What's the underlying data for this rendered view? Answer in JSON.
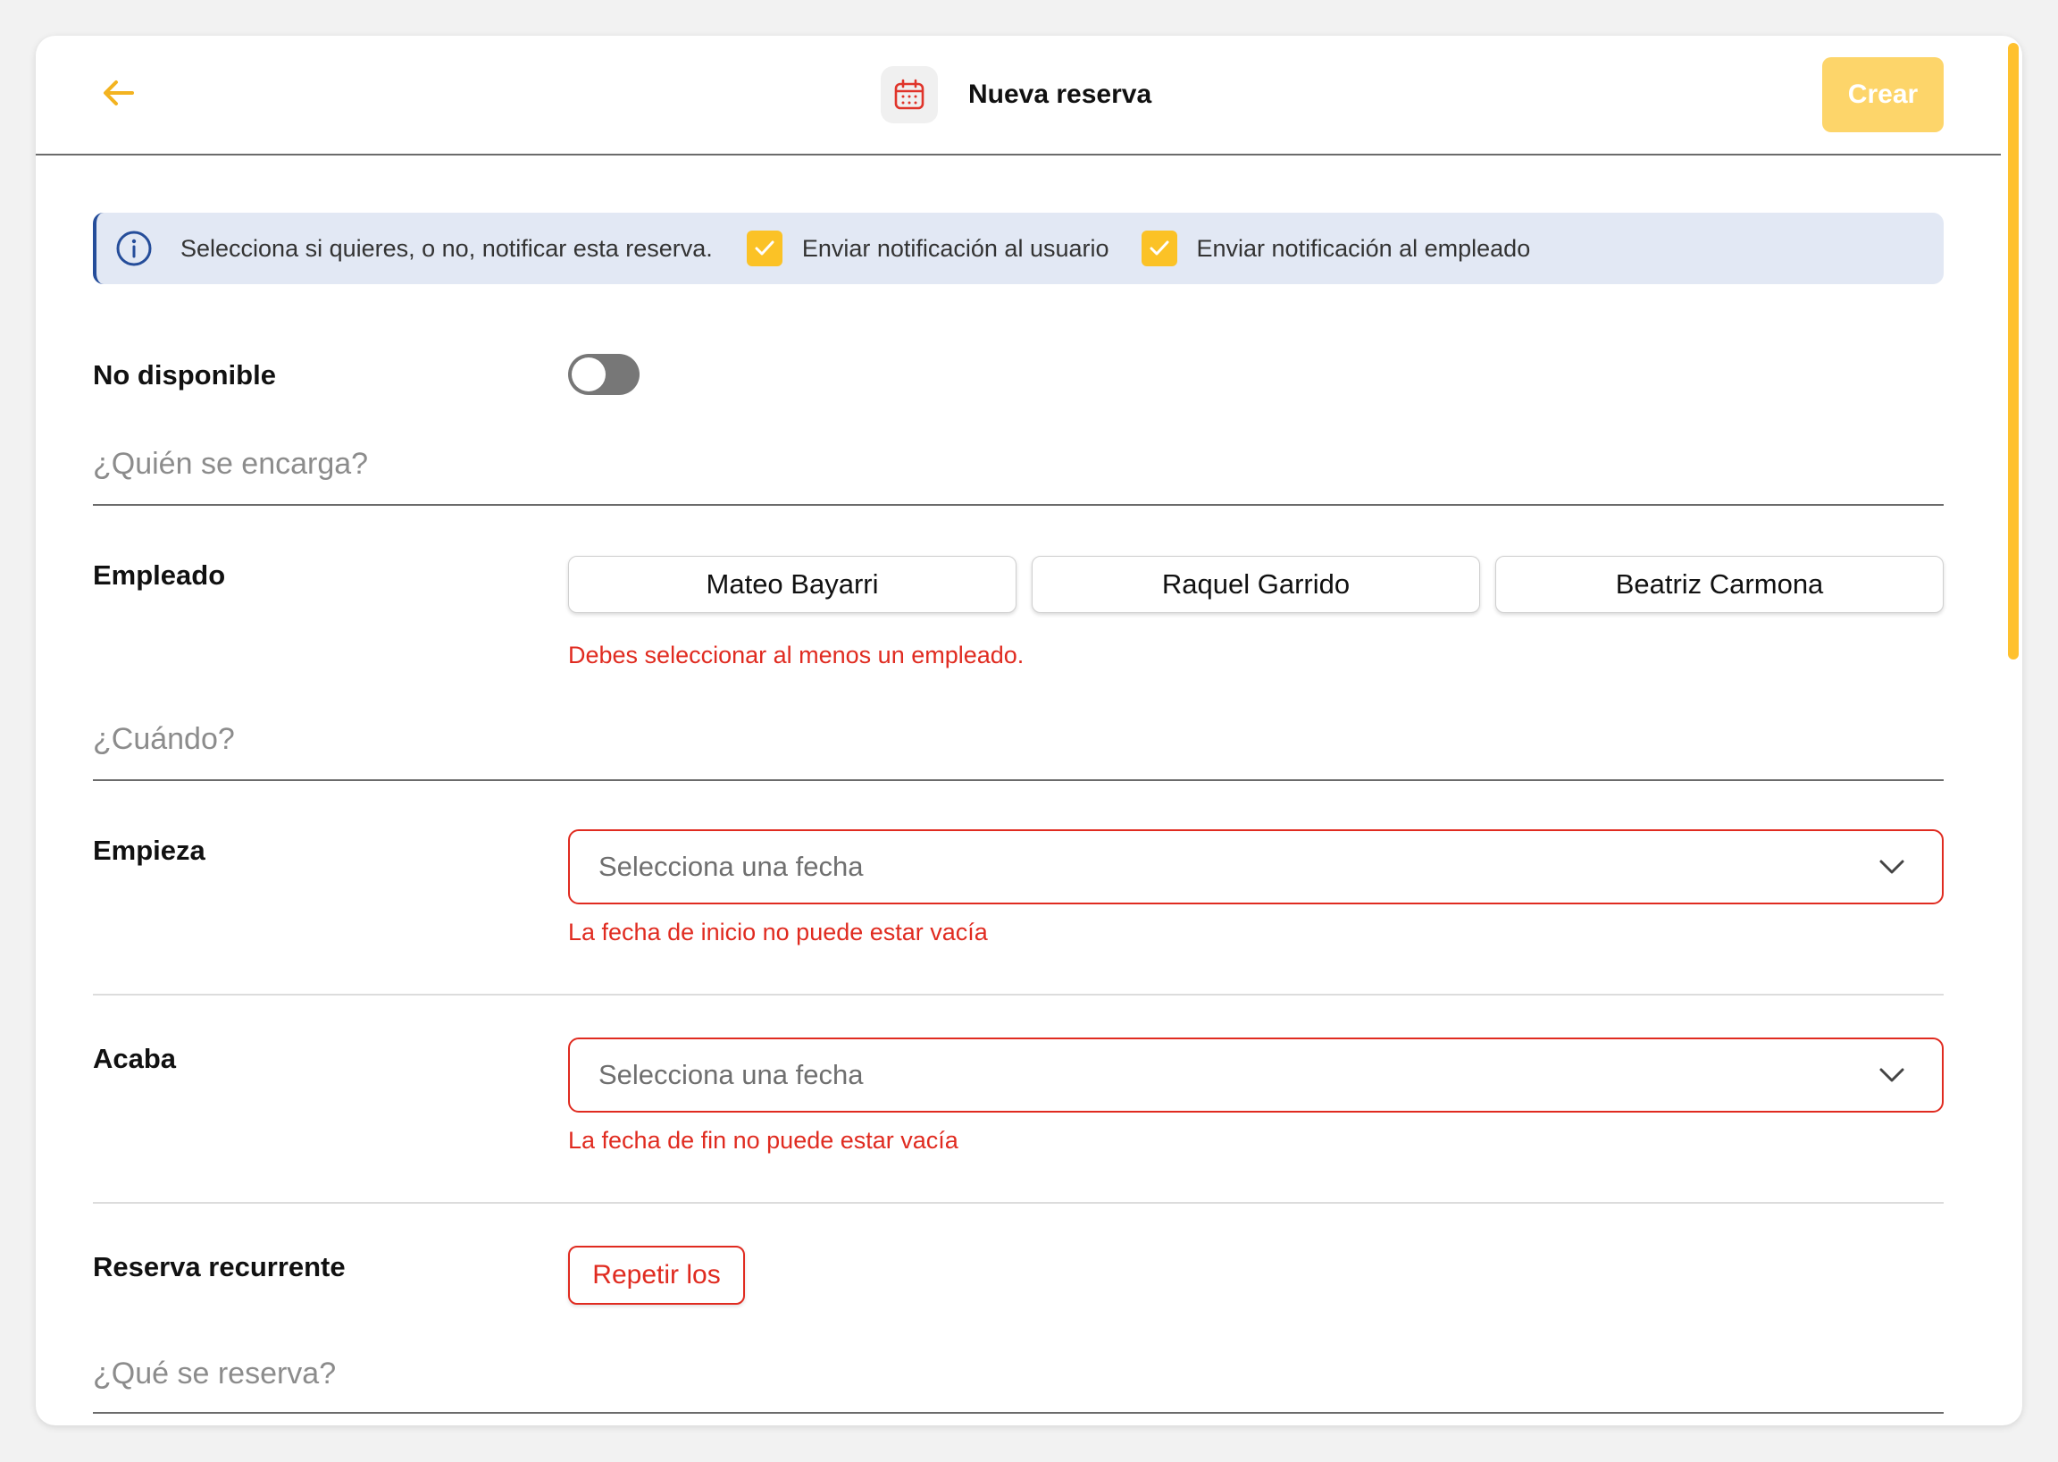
{
  "header": {
    "title": "Nueva reserva",
    "create_label": "Crear",
    "back_icon": "arrow-left-icon",
    "calendar_icon": "calendar-icon"
  },
  "banner": {
    "text": "Selecciona si quieres, o no, notificar esta reserva.",
    "notify_user": {
      "label": "Enviar notificación al usuario",
      "checked": true
    },
    "notify_employee": {
      "label": "Enviar notificación al empleado",
      "checked": true
    }
  },
  "unavailable": {
    "label": "No disponible",
    "on": false
  },
  "who": {
    "section_title": "¿Quién se encarga?",
    "employee_label": "Empleado",
    "employees": [
      "Mateo Bayarri",
      "Raquel Garrido",
      "Beatriz Carmona"
    ],
    "error": "Debes seleccionar al menos un empleado."
  },
  "when": {
    "section_title": "¿Cuándo?",
    "start": {
      "label": "Empieza",
      "placeholder": "Selecciona una fecha",
      "error": "La fecha de inicio no puede estar vacía"
    },
    "end": {
      "label": "Acaba",
      "placeholder": "Selecciona una fecha",
      "error": "La fecha de fin no puede estar vacía"
    }
  },
  "recurring": {
    "label": "Reserva recurrente",
    "button_label": "Repetir los"
  },
  "what": {
    "section_title": "¿Qué se reserva?"
  },
  "colors": {
    "accent": "#fbc226",
    "create_button": "#fdd56a",
    "error": "#e02b20",
    "banner_bg": "#e2e8f4",
    "info": "#254d9a"
  }
}
